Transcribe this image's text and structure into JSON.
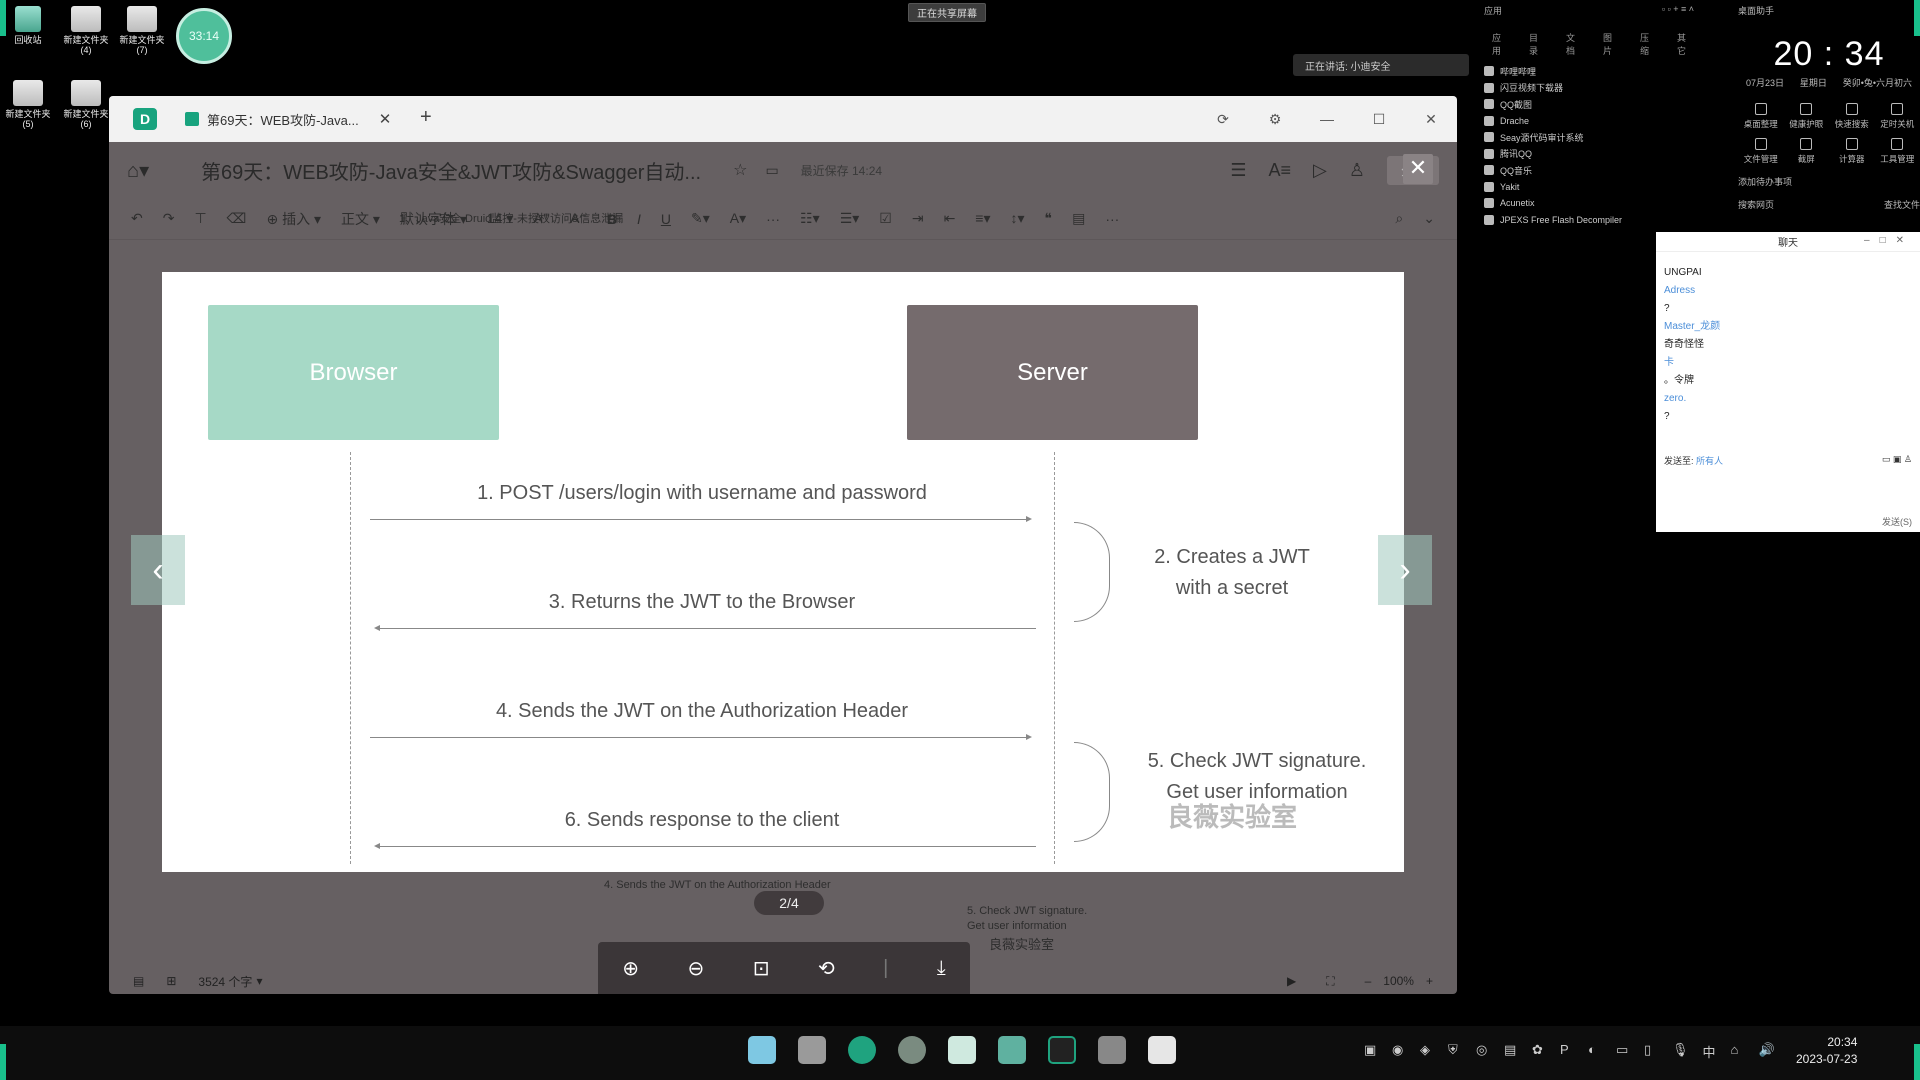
{
  "desktop": {
    "icons": [
      {
        "label": "回收站"
      },
      {
        "label": "新建文件夹\n(4)"
      },
      {
        "label": "新建文件夹\n(7)"
      },
      {
        "label": "新建文件夹\n(5)"
      },
      {
        "label": "新建文件夹\n(6)"
      }
    ],
    "avatar_text": "33:14",
    "share_badge": "正在共享屏幕",
    "speaking": "正在讲话: 小迪安全"
  },
  "app_list": {
    "header": "应用",
    "tabs": [
      "应用",
      "目录",
      "文档",
      "图片",
      "压缩",
      "其它"
    ],
    "items": [
      "哔哩哔哩",
      "闪豆视频下载器",
      "QQ截图",
      "Drache",
      "Seay源代码审计系统",
      "腾讯QQ",
      "QQ音乐",
      "Yakit",
      "Acunetix",
      "JPEXS Free Flash Decompiler"
    ]
  },
  "clock_panel": {
    "title": "桌面助手",
    "time": "20 : 34",
    "date": "07月23日",
    "weekday": "星期日",
    "lunar": "癸卯•兔•六月初六",
    "tools": [
      "桌面整理",
      "健康护眼",
      "快速搜索",
      "定时关机",
      "文件管理",
      "截屏",
      "计算器",
      "工具管理"
    ],
    "add_todo": "添加待办事项",
    "search_web": "搜索网页",
    "search_file": "查找文件"
  },
  "chat": {
    "title": "聊天",
    "messages": [
      {
        "name": "",
        "text": "UNGPAI"
      },
      {
        "name": "Adress",
        "text": "?"
      },
      {
        "name": "Master_龙颜",
        "text": "奇奇怪怪"
      },
      {
        "name": "卡",
        "text": "。令牌"
      },
      {
        "name": "zero.",
        "text": "?"
      }
    ],
    "send_to_label": "发送至:",
    "send_to_value": "所有人",
    "send_button": "发送(S)"
  },
  "window": {
    "app_icon": "D",
    "tab_title": "第69天：WEB攻防-Java...",
    "doc_title": "第69天：WEB攻防-Java安全&JWT攻防&Swagger自动...",
    "saved_status": "最近保存 14:24",
    "share_button": "分享",
    "toolbar": {
      "insert": "插入",
      "style": "正文",
      "font": "默认字体",
      "size": "14"
    },
    "bg_heading": "1、Java安全-Druid监控-未授权访问&信息泄漏",
    "word_count": "3524 个字",
    "zoom": "100%"
  },
  "slide": {
    "browser_label": "Browser",
    "server_label": "Server",
    "messages": [
      "1. POST /users/login with username and password",
      "3. Returns the JWT to the Browser",
      "4. Sends the JWT on the Authorization Header",
      "6. Sends response to the client"
    ],
    "notes": [
      "2. Creates a JWT\nwith a secret",
      "5. Check JWT signature.\nGet user information"
    ],
    "watermark": "良薇实验室",
    "page_indicator": "2/4"
  },
  "bg_diagram": {
    "msg": "4. Sends the JWT on the Authorization Header",
    "note": "5. Check JWT signature.\nGet user information",
    "watermark": "良薇实验室"
  },
  "taskbar": {
    "time": "20:34",
    "date": "2023-07-23",
    "ime": "中"
  },
  "colors": {
    "browser_box": "#a6d9c6",
    "server_box": "#756b6d",
    "accent": "#18a37e"
  }
}
